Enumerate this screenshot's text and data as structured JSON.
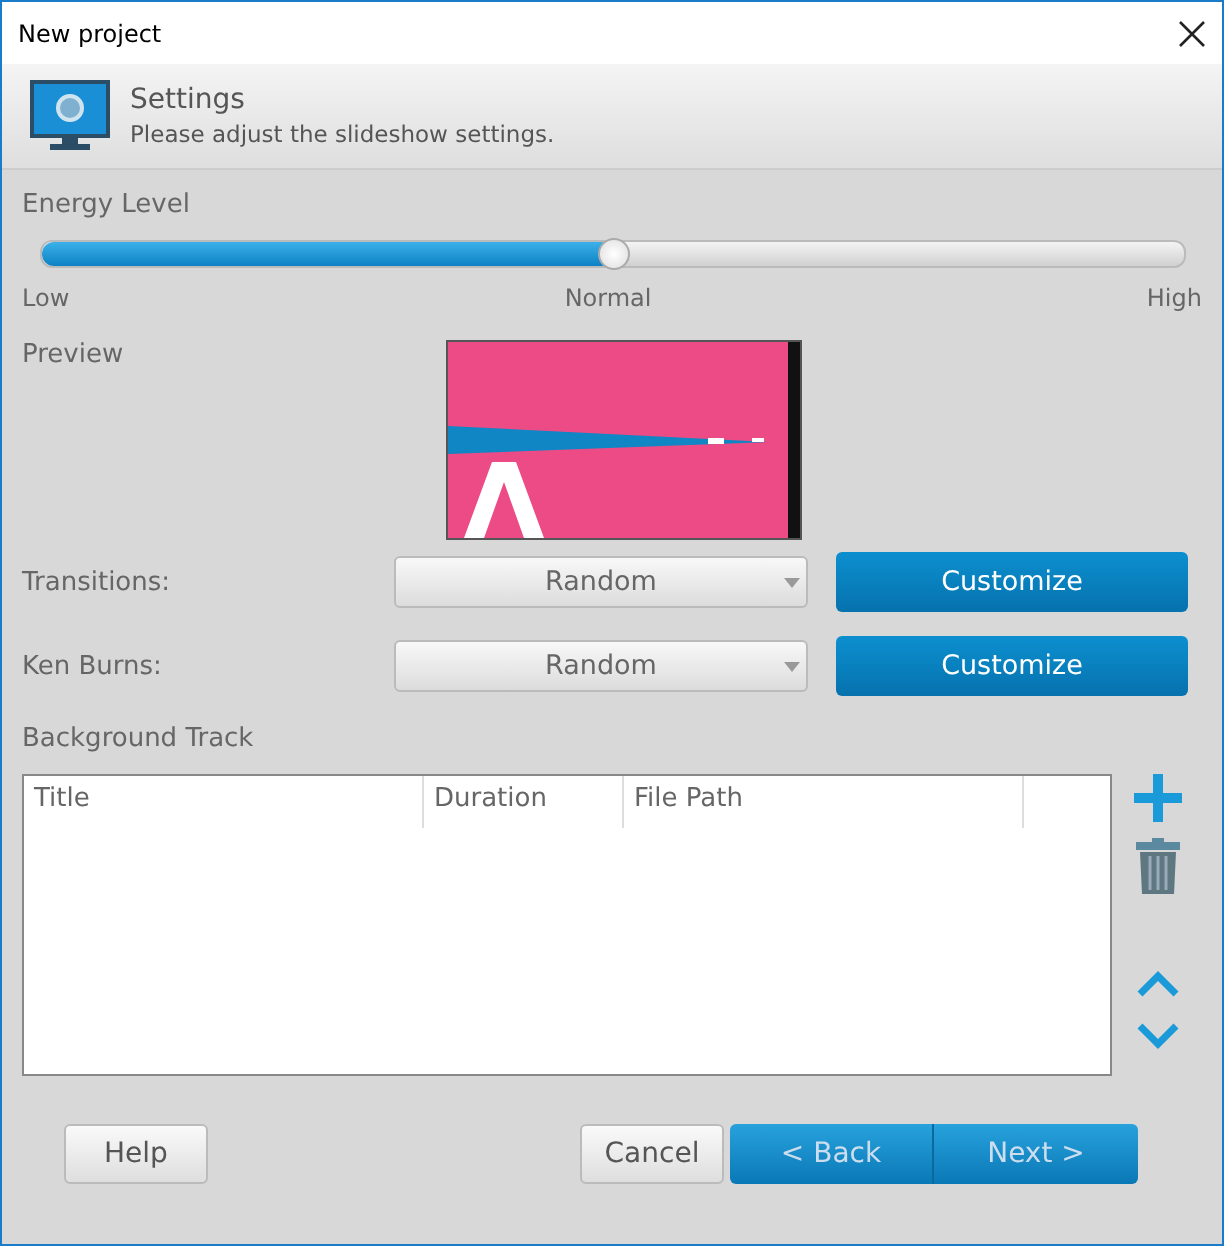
{
  "window": {
    "title": "New project"
  },
  "header": {
    "title": "Settings",
    "subtitle": "Please adjust the slideshow settings."
  },
  "energy": {
    "label": "Energy Level",
    "level": 0.5,
    "ticks": [
      "Low",
      "Normal",
      "High"
    ]
  },
  "preview": {
    "label": "Preview",
    "kind": "picture"
  },
  "options": [
    {
      "label": "Transitions:",
      "value": "Random",
      "button": "Customize"
    },
    {
      "label": "Ken Burns:",
      "value": "Random",
      "button": "Customize"
    }
  ],
  "track": {
    "label": "Background Track",
    "columns": [
      "Title",
      "Duration",
      "File Path"
    ]
  },
  "footer": {
    "help": "Help",
    "cancel": "Cancel",
    "back": "< Back",
    "next": "Next >"
  }
}
